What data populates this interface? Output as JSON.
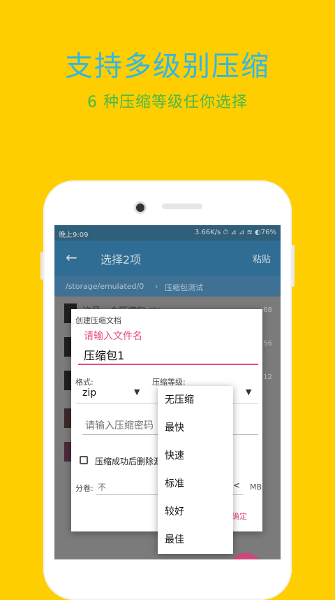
{
  "hero": {
    "title": "支持多级别压缩",
    "subtitle": "6 种压缩等级任你选择"
  },
  "status_bar": {
    "time": "晚上9:09",
    "right": "3.66K/s ⏱ ⊿ ⊿ ≋ ◐76%"
  },
  "app_bar": {
    "back_icon": "←",
    "title": "选择2项",
    "paste_label": "粘贴"
  },
  "path": {
    "root": "/storage/emulated/0",
    "sep": "›",
    "current": "压缩包测试"
  },
  "files": [
    {
      "name": "这是一个压缩包.zip",
      "meta": "68"
    },
    {
      "name": "",
      "meta": "56"
    },
    {
      "name": "",
      "meta": "12"
    }
  ],
  "dialog": {
    "title": "创建压缩文档",
    "name_hint": "请输入文件名",
    "name_value": "压缩包1",
    "format_label": "格式:",
    "level_label": "压缩等级:",
    "format_value": "zip",
    "caret": "▼",
    "password_placeholder": "请输入压缩密码",
    "delete_after_label": "压缩成功后删除源文件",
    "split_label": "分卷:",
    "split_placeholder": "不",
    "split_caret": "<",
    "split_unit": "MB",
    "ok_label": "确定"
  },
  "level_menu": {
    "options": [
      "无压缩",
      "最快",
      "快速",
      "标准",
      "较好",
      "最佳"
    ]
  },
  "colors": {
    "background": "#FFCE00",
    "title": "#2FB7E6",
    "subtitle": "#4CB848",
    "accent": "#E54B8B"
  }
}
